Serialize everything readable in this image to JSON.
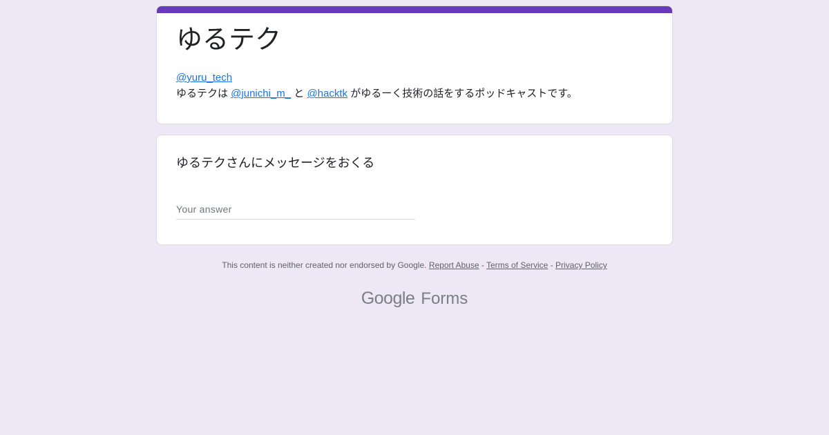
{
  "form": {
    "title": "ゆるテク",
    "accent_color": "#673ab7",
    "background_color": "#ede7f6",
    "description": {
      "handle_link": "@yuru_tech",
      "line2_prefix": "ゆるテクは ",
      "mention_1": "@junichi_m_",
      "between": " と ",
      "mention_2": "@hacktk",
      "line2_suffix": " がゆるーく技術の話をするポッドキャストです。"
    }
  },
  "question": {
    "label": "ゆるテクさんにメッセージをおくる",
    "placeholder": "Your answer",
    "value": ""
  },
  "footer": {
    "disclaimer": "This content is neither created nor endorsed by Google. ",
    "report_abuse": "Report Abuse",
    "sep1": " - ",
    "terms": "Terms of Service",
    "sep2": " - ",
    "privacy": "Privacy Policy"
  },
  "brand": {
    "google": "Google",
    "forms": "Forms"
  }
}
